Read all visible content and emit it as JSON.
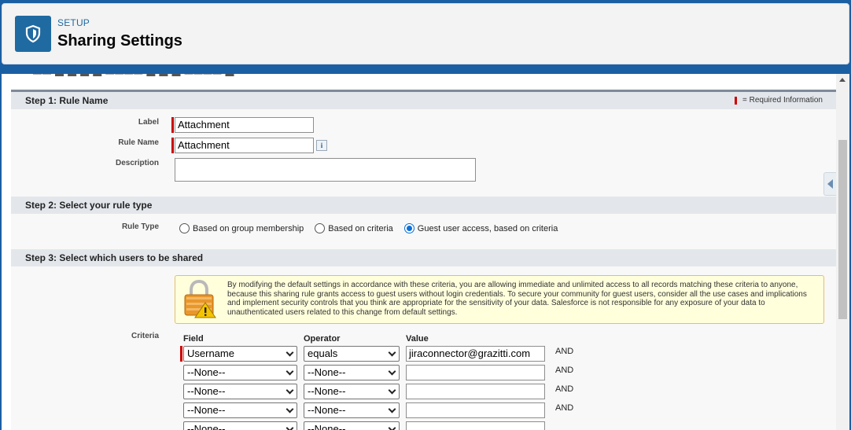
{
  "header": {
    "setup_label": "SETUP",
    "title": "Sharing Settings",
    "icon": "shield-icon"
  },
  "required_info": "= Required Information",
  "step1": {
    "title": "Step 1: Rule Name",
    "label_caption": "Label",
    "label_value": "Attachment",
    "rule_name_caption": "Rule Name",
    "rule_name_value": "Attachment",
    "info_glyph": "i",
    "description_caption": "Description",
    "description_value": ""
  },
  "step2": {
    "title": "Step 2: Select your rule type",
    "rule_type_caption": "Rule Type",
    "options": [
      {
        "label": "Based on group membership",
        "selected": false
      },
      {
        "label": "Based on criteria",
        "selected": false
      },
      {
        "label": "Guest user access, based on criteria",
        "selected": true
      }
    ]
  },
  "step3": {
    "title": "Step 3: Select which users to be shared",
    "warning": "By modifying the default settings in accordance with these criteria, you are allowing immediate and unlimited access to all records matching these criteria to anyone, because this sharing rule grants access to guest users without login credentials. To secure your community for guest users, consider all the use cases and implications and implement security controls that you think are appropriate for the sensitivity of your data. Salesforce is not responsible for any exposure of your data to unauthenticated users related to this change from default settings.",
    "criteria_caption": "Criteria",
    "columns": {
      "field": "Field",
      "operator": "Operator",
      "value": "Value"
    },
    "rows": [
      {
        "field": "Username",
        "operator": "equals",
        "value": "jiraconnector@grazitti.com",
        "logic": "AND"
      },
      {
        "field": "--None--",
        "operator": "--None--",
        "value": "",
        "logic": "AND"
      },
      {
        "field": "--None--",
        "operator": "--None--",
        "value": "",
        "logic": "AND"
      },
      {
        "field": "--None--",
        "operator": "--None--",
        "value": "",
        "logic": "AND"
      },
      {
        "field": "--None--",
        "operator": "--None--",
        "value": "",
        "logic": ""
      }
    ]
  },
  "colors": {
    "brand": "#1b5fa3",
    "required": "#cc0000",
    "radio_selected": "#0b6fd8",
    "warning_bg": "#ffffdc"
  }
}
